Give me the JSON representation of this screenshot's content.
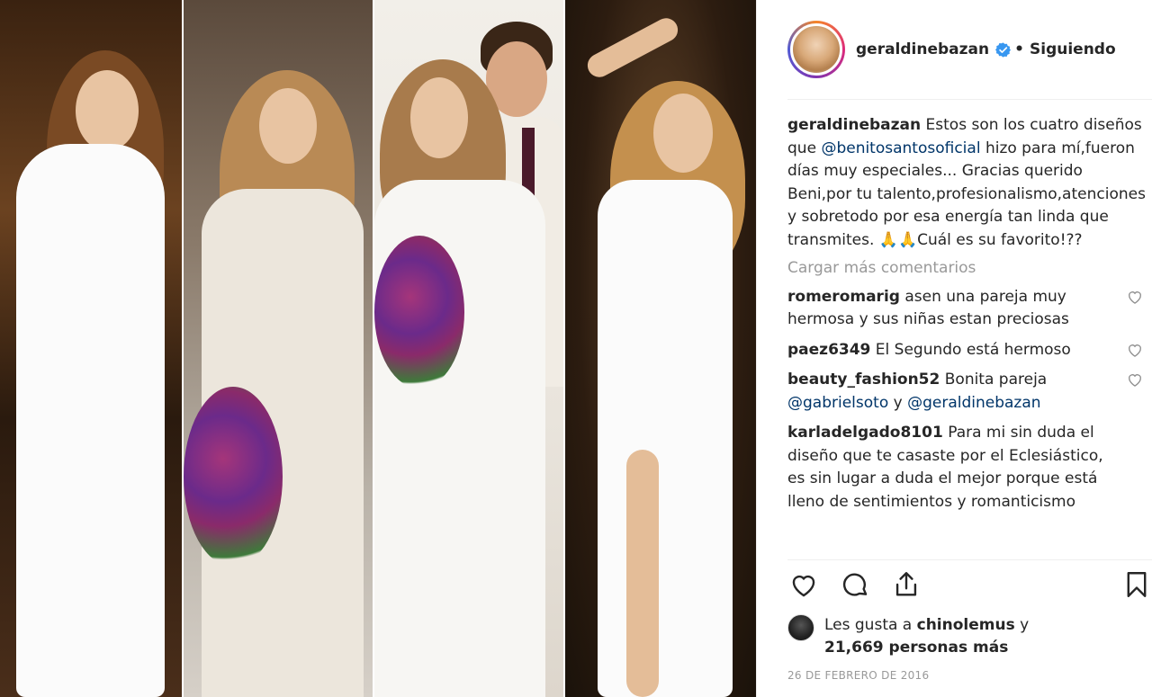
{
  "post": {
    "username": "geraldinebazan",
    "follow_status": "Siguiendo",
    "separator": "•",
    "caption_user": "geraldinebazan",
    "caption_part1": "Estos son los cuatro diseños que",
    "caption_mention": "@benitosantosoficial",
    "caption_part2": "hizo para mí,fueron días muy especiales... Gracias querido Beni,por tu talento,profesionalismo,atenciones y sobretodo por esa energía tan linda que transmites. 🙏🙏Cuál es su favorito!??",
    "load_more": "Cargar más comentarios",
    "comments": [
      {
        "user": "romeromarig",
        "text": "asen una pareja muy hermosa y sus niñas estan preciosas"
      },
      {
        "user": "paez6349",
        "text": "El Segundo está hermoso"
      },
      {
        "user": "beauty_fashion52",
        "text": "Bonita pareja",
        "mention1": "@gabrielsoto",
        "conj": "y",
        "mention2": "@geraldinebazan"
      },
      {
        "user": "karladelgado8101",
        "text": "Para mi sin duda el diseño que te casaste por el Eclesiástico, es sin lugar a duda el mejor porque está lleno de sentimientos y romanticismo"
      }
    ],
    "likes_prefix": "Les gusta a",
    "likes_user": "chinolemus",
    "likes_conj": "y",
    "likes_count": "21,669 personas más",
    "date": "26 DE FEBRERO DE 2016"
  },
  "icons": {
    "verified": "verified-badge-icon",
    "like": "heart-icon",
    "comment": "comment-bubble-icon",
    "share": "share-icon",
    "save": "bookmark-icon"
  },
  "colors": {
    "text": "#262626",
    "muted": "#999999",
    "mention": "#003569",
    "verified": "#3897f0",
    "border": "#efefef"
  }
}
